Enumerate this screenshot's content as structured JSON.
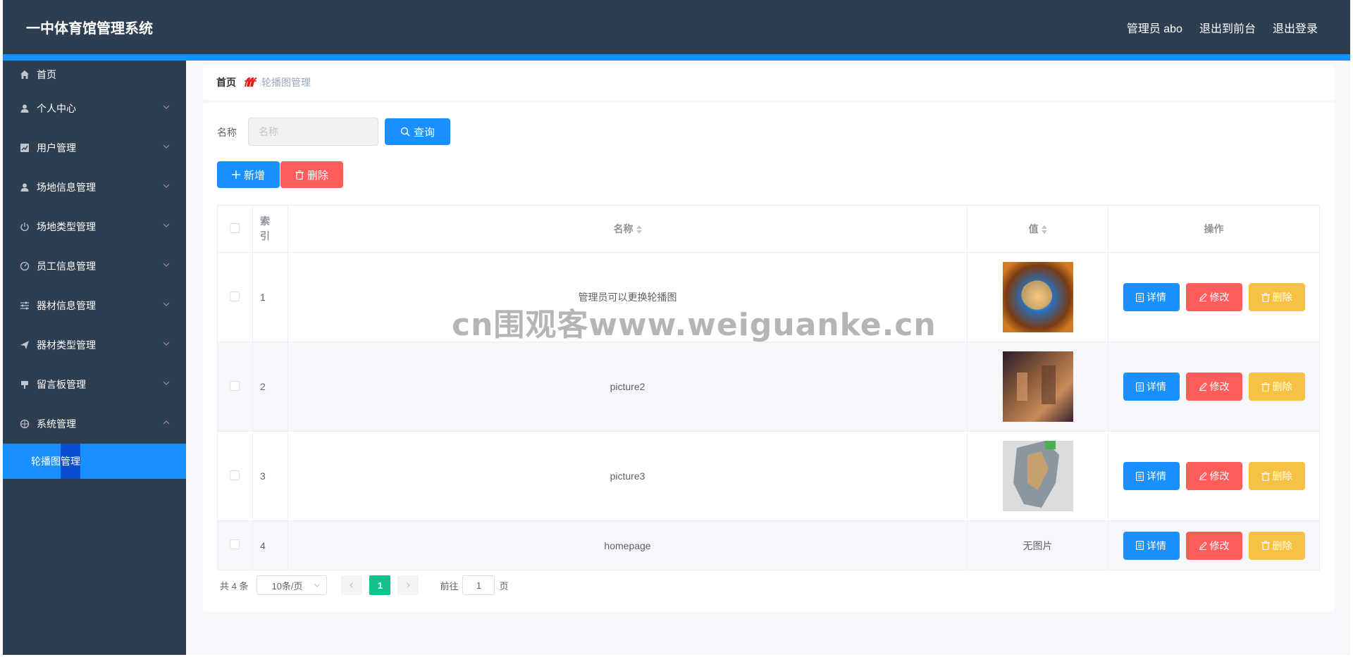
{
  "header": {
    "title": "一中体育馆管理系统",
    "admin_label": "管理员 abo",
    "to_front": "退出到前台",
    "logout": "退出登录"
  },
  "sidebar": {
    "items": [
      {
        "label": "首页",
        "icon": "home-icon"
      },
      {
        "label": "个人中心",
        "icon": "user-icon"
      },
      {
        "label": "用户管理",
        "icon": "chart-icon"
      },
      {
        "label": "场地信息管理",
        "icon": "user-icon"
      },
      {
        "label": "场地类型管理",
        "icon": "power-icon"
      },
      {
        "label": "员工信息管理",
        "icon": "gauge-icon"
      },
      {
        "label": "器材信息管理",
        "icon": "sliders-icon"
      },
      {
        "label": "器材类型管理",
        "icon": "send-icon"
      },
      {
        "label": "留言板管理",
        "icon": "pin-icon"
      },
      {
        "label": "系统管理",
        "icon": "compass-icon"
      }
    ],
    "sub_item": "轮播图管理"
  },
  "breadcrumb": {
    "home": "首页",
    "current": "轮播图管理"
  },
  "search": {
    "label": "名称",
    "placeholder": "名称",
    "query_button": "查询"
  },
  "actions": {
    "add": "新增",
    "delete": "删除"
  },
  "table": {
    "headers": {
      "index": "索引",
      "name": "名称",
      "value": "值",
      "ops": "操作"
    },
    "rows": [
      {
        "index": "1",
        "name": "管理员可以更换轮播图",
        "value": "image",
        "thumb_color": "#2a6fb8"
      },
      {
        "index": "2",
        "name": "picture2",
        "value": "image",
        "thumb_color": "#6b4a3a"
      },
      {
        "index": "3",
        "name": "picture3",
        "value": "image",
        "thumb_color": "#a8a49c"
      },
      {
        "index": "4",
        "name": "homepage",
        "value": "无图片"
      }
    ],
    "op_labels": {
      "detail": "详情",
      "edit": "修改",
      "remove": "删除"
    }
  },
  "pager": {
    "total": "共 4 条",
    "page_size": "10条/页",
    "current_page": "1",
    "goto_label": "前往",
    "goto_value": "1",
    "page_unit": "页"
  },
  "watermark": "cn围观客www.weiguanke.cn",
  "colors": {
    "header_bg": "#2d3e50",
    "primary": "#1890ff",
    "danger": "#ff5c5c",
    "warning": "#f7c244",
    "page_active": "#13c28a"
  }
}
